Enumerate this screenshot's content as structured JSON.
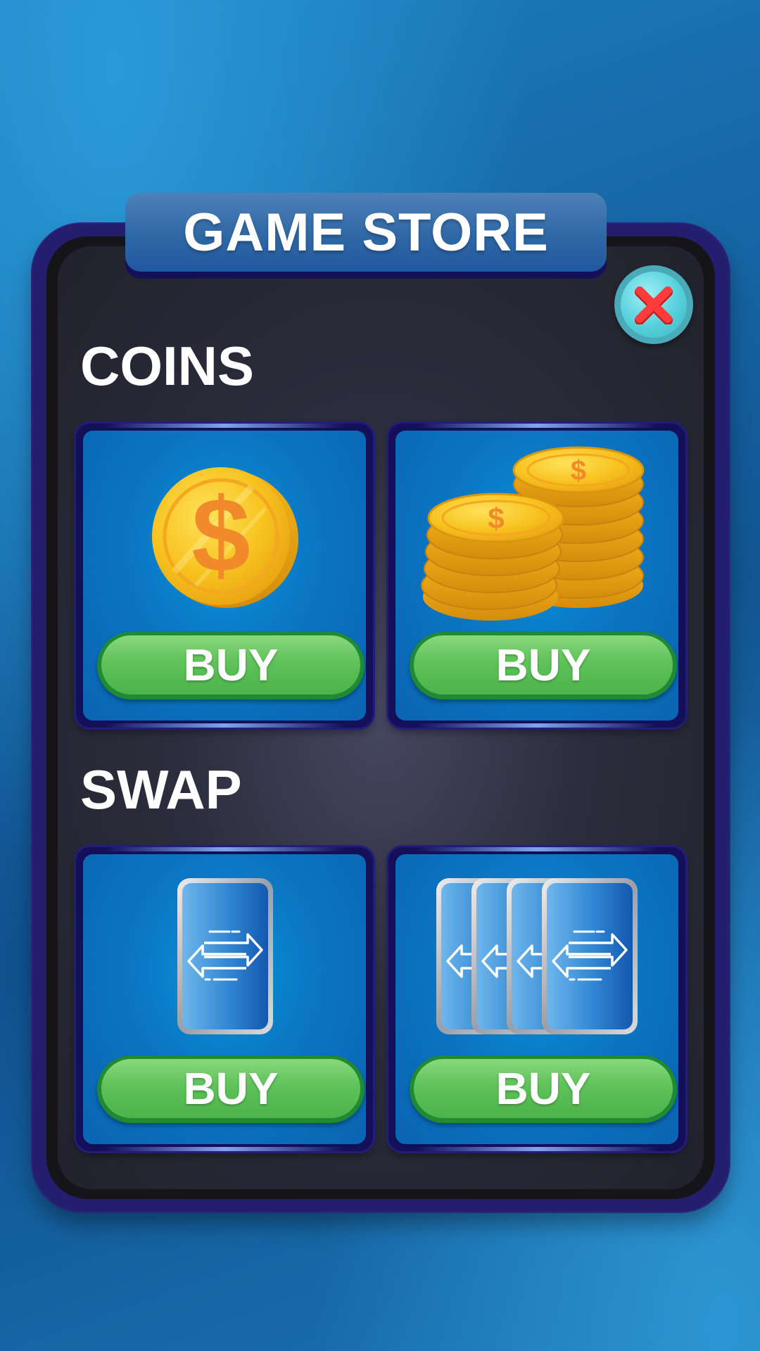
{
  "store": {
    "title": "GAME STORE",
    "close_icon": "close-x-icon"
  },
  "sections": [
    {
      "title": "COINS",
      "items": [
        {
          "icon": "single-coin-icon",
          "buy_label": "BUY"
        },
        {
          "icon": "coin-stacks-icon",
          "buy_label": "BUY"
        }
      ]
    },
    {
      "title": "SWAP",
      "items": [
        {
          "icon": "single-swap-card-icon",
          "buy_label": "BUY"
        },
        {
          "icon": "swap-card-pack-icon",
          "buy_label": "BUY"
        }
      ]
    }
  ],
  "colors": {
    "background": "#135a98",
    "panel": "#2c2d3c",
    "card": "#0b76c3",
    "buy_button": "#5fc25a",
    "coin": "#f7c21e",
    "close_x": "#ff3b3b"
  }
}
